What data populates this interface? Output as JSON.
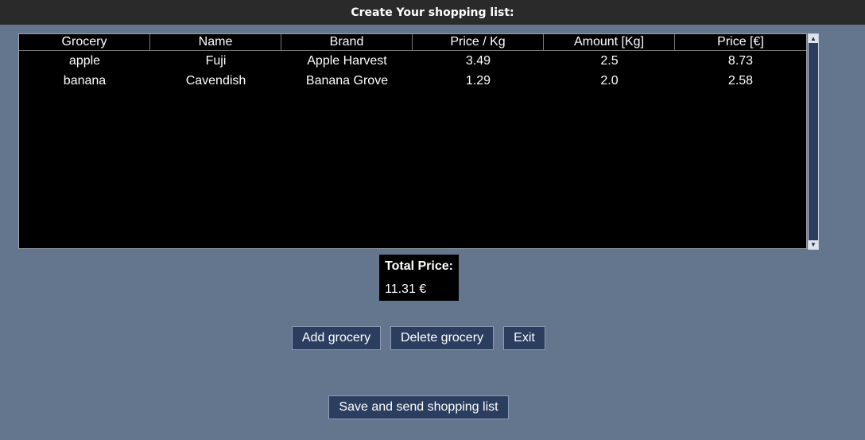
{
  "window": {
    "title": "Create Your shopping list:"
  },
  "table": {
    "columns": [
      "Grocery",
      "Name",
      "Brand",
      "Price / Kg",
      "Amount [Kg]",
      "Price [€]"
    ],
    "rows": [
      [
        "apple",
        "Fuji",
        "Apple Harvest",
        "3.49",
        "2.5",
        "8.73"
      ],
      [
        "banana",
        "Cavendish",
        "Banana Grove",
        "1.29",
        "2.0",
        "2.58"
      ]
    ]
  },
  "scrollbar": {
    "up_icon": "triangle-up-icon",
    "down_icon": "triangle-down-icon"
  },
  "total": {
    "label": "Total Price:",
    "value": "11.31 €"
  },
  "buttons": {
    "add": "Add grocery",
    "delete": "Delete grocery",
    "exit": "Exit",
    "save_send": "Save and send shopping list"
  },
  "colors": {
    "background": "#64768e",
    "titlebar": "#2a2a2a",
    "table_bg": "#000000",
    "button_bg": "#2c3e60"
  }
}
